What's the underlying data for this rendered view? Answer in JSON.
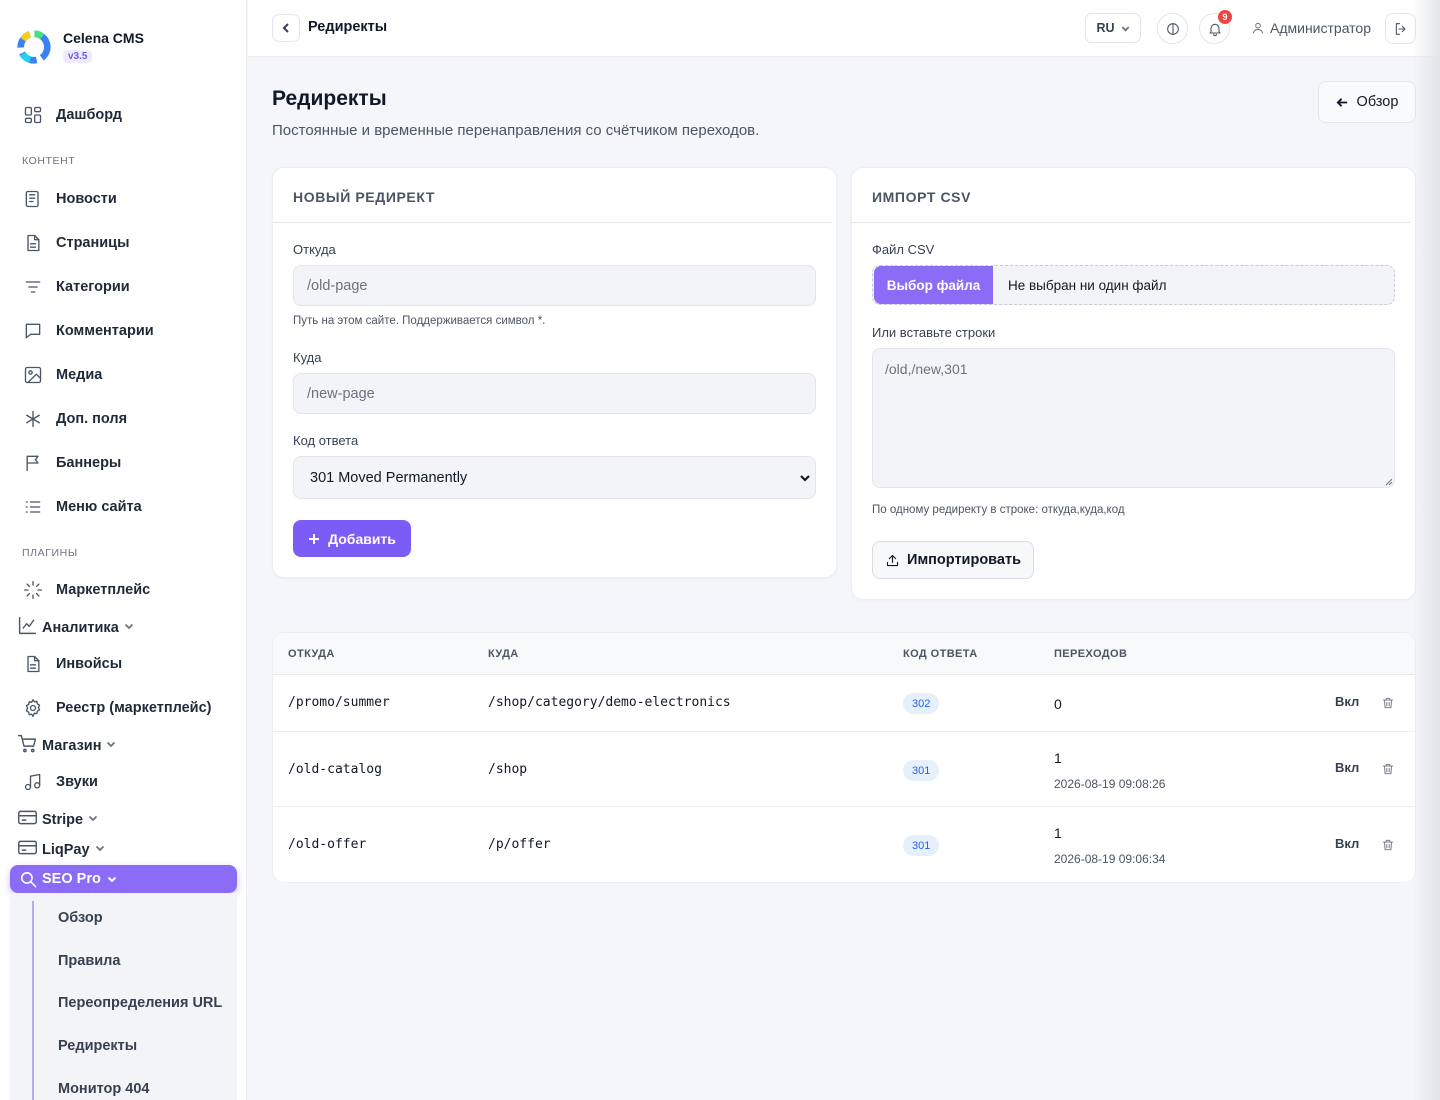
{
  "brand": {
    "name": "Celena CMS",
    "version": "v3.5"
  },
  "sidebar": {
    "dashboard": "Дашборд",
    "section_content": "КОНТЕНТ",
    "content_items": [
      "Новости",
      "Страницы",
      "Категории",
      "Комментарии",
      "Медиа",
      "Доп. поля",
      "Баннеры",
      "Меню сайта"
    ],
    "section_plugins": "ПЛАГИНЫ",
    "marketplace": "Маркетплейс",
    "analytics": "Аналитика",
    "invoices": "Инвойсы",
    "registry": "Реестр (маркетплейс)",
    "shop": "Магазин",
    "sounds": "Звуки",
    "stripe": "Stripe",
    "liqpay": "LiqPay",
    "seo_pro": "SEO Pro",
    "seo_sub": [
      "Обзор",
      "Правила",
      "Переопределения URL",
      "Редиректы",
      "Монитор 404"
    ]
  },
  "topbar": {
    "title": "Редиректы",
    "lang": "RU",
    "notifications_count": "9",
    "user": "Администратор"
  },
  "header": {
    "title": "Редиректы",
    "subtitle": "Постоянные и временные перенаправления со счётчиком переходов.",
    "overview_btn": "Обзор"
  },
  "new_redirect": {
    "heading": "НОВЫЙ РЕДИРЕКТ",
    "from_label": "Откуда",
    "from_placeholder": "/old-page",
    "from_hint": "Путь на этом сайте. Поддерживается символ *.",
    "to_label": "Куда",
    "to_placeholder": "/new-page",
    "code_label": "Код ответа",
    "code_value": "301 Moved Permanently",
    "add_btn": "Добавить"
  },
  "import_csv": {
    "heading": "ИМПОРТ CSV",
    "file_label": "Файл CSV",
    "file_btn": "Выбор файла",
    "file_none": "Не выбран ни один файл",
    "paste_label": "Или вставьте строки",
    "paste_placeholder": "/old,/new,301",
    "hint": "По одному редиректу в строке: откуда,куда,код",
    "import_btn": "Импортировать"
  },
  "table": {
    "headers": [
      "ОТКУДА",
      "КУДА",
      "КОД ОТВЕТА",
      "ПЕРЕХОДОВ"
    ],
    "rows": [
      {
        "from": "/promo/summer",
        "to": "/shop/category/demo-electronics",
        "code": "302",
        "hits": "0",
        "last": "",
        "toggle": "Вкл"
      },
      {
        "from": "/old-catalog",
        "to": "/shop",
        "code": "301",
        "hits": "1",
        "last": "2026-08-19 09:08:26",
        "toggle": "Вкл"
      },
      {
        "from": "/old-offer",
        "to": "/p/offer",
        "code": "301",
        "hits": "1",
        "last": "2026-08-19 09:06:34",
        "toggle": "Вкл"
      }
    ]
  },
  "colors": {
    "accent": "#7c5cf6",
    "accent_light": "#8b6cf6",
    "badge_bg": "#e6f0fb",
    "badge_text": "#2563eb",
    "danger": "#ef4444"
  }
}
